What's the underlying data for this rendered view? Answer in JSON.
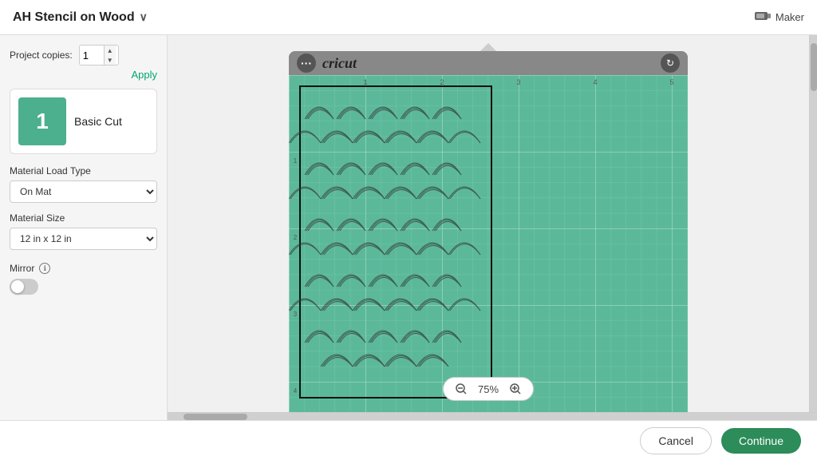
{
  "header": {
    "title": "AH Stencil on Wood",
    "chevron": "∨",
    "maker_label": "Maker",
    "maker_icon": "⬛"
  },
  "sidebar": {
    "project_copies_label": "Project copies:",
    "copies_value": "1",
    "apply_label": "Apply",
    "mat_number": "1",
    "mat_label": "Basic Cut",
    "material_load_type_label": "Material Load Type",
    "material_load_type_value": "On Mat",
    "material_size_label": "Material Size",
    "material_size_value": "12 in x 12 in",
    "mirror_label": "Mirror",
    "info_icon_label": "ℹ"
  },
  "canvas": {
    "brand": "cricut",
    "zoom_level": "75%"
  },
  "footer": {
    "cancel_label": "Cancel",
    "continue_label": "Continue"
  }
}
